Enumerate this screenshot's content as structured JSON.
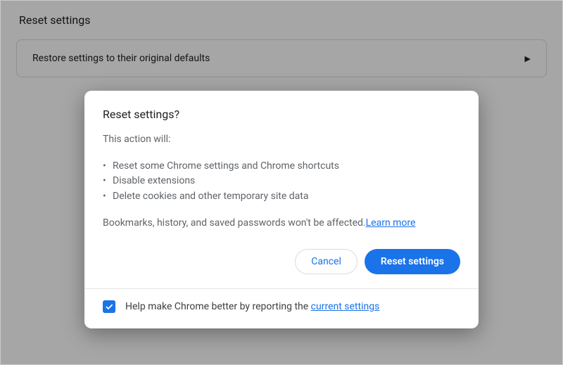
{
  "page": {
    "section_title": "Reset settings",
    "row": {
      "label": "Restore settings to their original defaults"
    }
  },
  "dialog": {
    "title": "Reset settings?",
    "lead": "This action will:",
    "bullets": [
      "Reset some Chrome settings and Chrome shortcuts",
      "Disable extensions",
      "Delete cookies and other temporary site data"
    ],
    "note_prefix": "Bookmarks, history, and saved passwords won't be affected.",
    "learn_more": "Learn more",
    "actions": {
      "cancel": "Cancel",
      "confirm": "Reset settings"
    },
    "footer": {
      "checked": true,
      "text_prefix": "Help make Chrome better by reporting the ",
      "link": "current settings"
    }
  }
}
